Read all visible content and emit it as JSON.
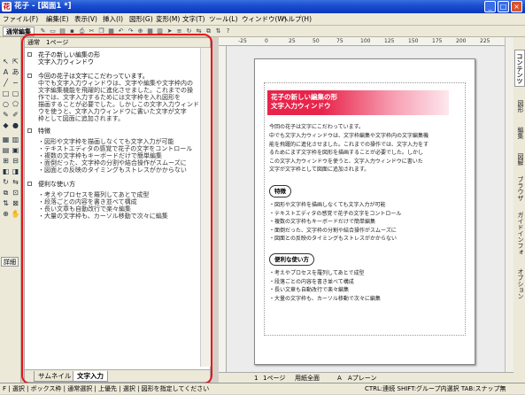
{
  "window": {
    "title": "花子 - [図面1 *]",
    "app_icon": "花",
    "minimize": "_",
    "maximize": "□",
    "close": "×"
  },
  "menu": [
    "ファイル(F)",
    "編集(E)",
    "表示(V)",
    "挿入(I)",
    "図形(G)",
    "変形(M)",
    "文字(T)",
    "ツール(L)",
    "ウィンドウ(W)",
    "ヘルプ(H)"
  ],
  "toolbar": {
    "mode_label": "通常編集",
    "icons": [
      "pen-icon",
      "frame-icon",
      "open-icon",
      "save-icon",
      "print-icon",
      "cut-icon",
      "copy-icon",
      "paste-icon",
      "undo-icon",
      "redo-icon",
      "zoom-icon",
      "grid-icon",
      "table-icon",
      "arrow-icon",
      "align-icon",
      "rotate-icon",
      "flip-icon",
      "group-icon",
      "order-icon",
      "help-icon"
    ]
  },
  "palette": {
    "detail_label": "詳細",
    "tools": [
      "select-icon",
      "text-icon",
      "line-icon",
      "rect-icon",
      "circle-icon",
      "pen-icon",
      "paint-icon",
      "zoom-icon"
    ]
  },
  "outline": {
    "header": "通常　1ページ",
    "sections": [
      {
        "title": "花子の新しい編集の形\n文字入力ウィンドウ",
        "body": ""
      },
      {
        "title": "今回の花子は文字にこだわっています。",
        "body": "中でも文字入力ウィンドウは、文字や編集や文字枠内の\n文字編集機能を飛躍的に進化させました。これまでの操\n作では、文字入力するためには文字枠を入れ図形を\n描画することが必要でした。しかしこの文字入力ウィンド\nウを使うと、文字入力ウィンドウに書いた文字が文字\n枠として図面に追加されます。"
      },
      {
        "title": "特徴",
        "body": "・図形や文字枠を描画しなくても文字入力が可能\n・テキストエディタの感覚で花子の文字をコントロール\n・複数の文字枠もキーボードだけで簡単編集\n・面倒だった、文字枠の分割や結合操作がスムーズに\n・図面との反映のタイミングもストレスがかからない"
      },
      {
        "title": "便利な使い方",
        "body": "・考えやプロセスを羅列してあとで成型\n・段落ごとの内容を書き並べて構成\n・長い文章も自動改行で楽々編集\n・大量の文字枠も、カーソル移動で次々に編集"
      }
    ],
    "tabs": [
      "サムネイル",
      "文字入力"
    ]
  },
  "ruler": {
    "ticks": [
      "-25",
      "0",
      "25",
      "50",
      "75",
      "100",
      "125",
      "150",
      "175",
      "200",
      "225"
    ]
  },
  "page": {
    "title_line1": "花子の新しい編集の形",
    "title_line2": "文字入力ウィンドウ",
    "intro_lead": "今回の花子は文字にこだわっています。",
    "intro_body": "中でも文字入力ウィンドウは、文字枠編集や文字枠内の文字編集機\n能を飛躍的に進化させました。これまでの操作では、文字入力をす\nるためにまず文字枠を図形を描画することが必要でした。しかし\nこの文字入力ウィンドウを使うと、文字入力ウィンドウに書いた\n文字が文字枠として図面に追加されます。",
    "features_label": "特徴",
    "features": "・図形や文字枠を描画しなくても文字入力が可能\n・テキストエディタの感覚で花子の文字をコントロール\n・複数の文字枠もキーボードだけで簡単編集\n・面倒だった、文字枠の分割や結合操作がスムーズに\n・図面との反映のタイミングもストレスがかからない",
    "usage_label": "便利な使い方",
    "usage": "・考えやプロセスを羅列してあとで成型\n・段落ごとの内容を書き並べて構成\n・長い文章も自動改行で楽々編集\n・大量の文字枠も、カーソル移動で次々に編集"
  },
  "side_tabs": [
    "コンテンツ",
    "図形",
    "編集",
    "図解",
    "ブラウザ",
    "ガイドインフォ",
    "オプション"
  ],
  "doc_status": {
    "page": "1",
    "page_label": "1ページ",
    "paper": "用紙全面",
    "layer": "A",
    "layer_label": "Aプレーン"
  },
  "status": {
    "left": "F | 選択 | ボックス枠 | 通常選択 | 上優先 | 選択 | 図形を指定してください",
    "right": "CTRL:連続 SHIFT:グループ内選択 TAB:スナップ無"
  },
  "colors": {
    "highlight": "#e8141c",
    "title_band": "#e8244a"
  }
}
